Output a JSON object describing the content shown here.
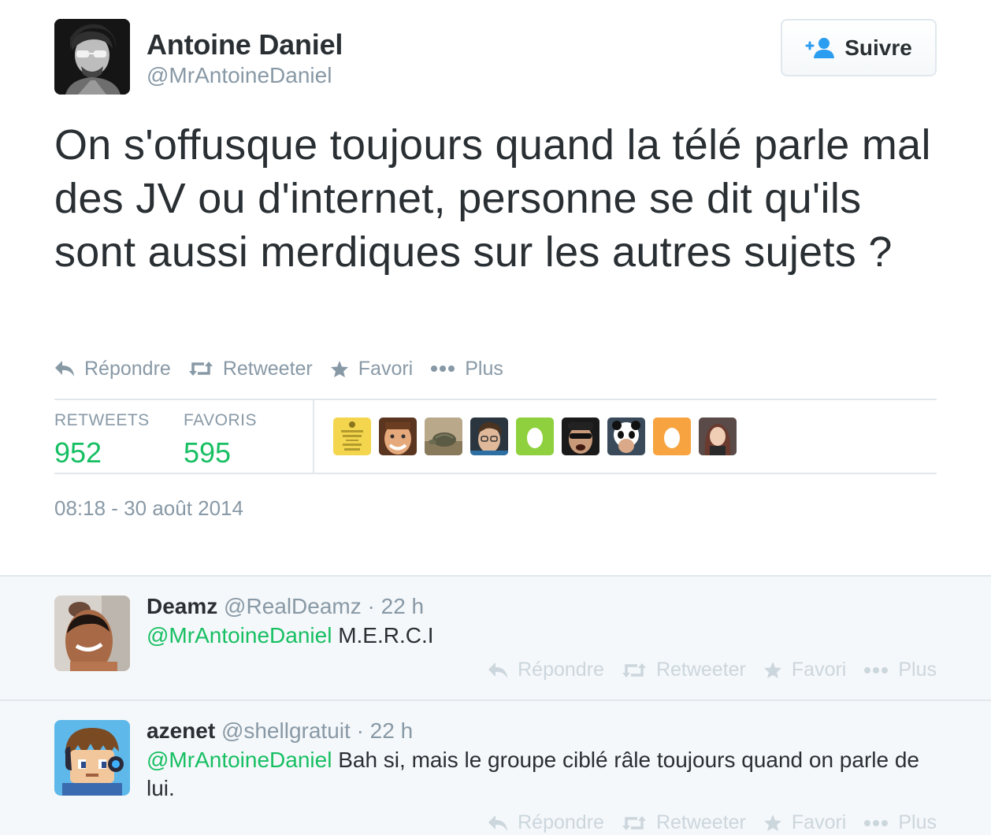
{
  "tweet": {
    "author_name": "Antoine Daniel",
    "author_handle": "@MrAntoineDaniel",
    "follow_label": "Suivre",
    "text": "On s'offusque toujours quand la télé parle mal des JV ou d'internet, personne se dit qu'ils sont aussi merdiques sur les autres sujets ?",
    "actions": {
      "reply": "Répondre",
      "retweet": "Retweeter",
      "favorite": "Favori",
      "more": "Plus"
    },
    "stats": {
      "retweets_label": "RETWEETS",
      "retweets_value": "952",
      "favorites_label": "FAVORIS",
      "favorites_value": "595"
    },
    "timestamp": "08:18 - 30 août 2014"
  },
  "replies": [
    {
      "name": "Deamz",
      "handle": "@RealDeamz",
      "time": "· 22 h",
      "mention": "@MrAntoineDaniel",
      "text": " M.E.R.C.I",
      "actions": {
        "reply": "Répondre",
        "retweet": "Retweeter",
        "favorite": "Favori",
        "more": "Plus"
      }
    },
    {
      "name": "azenet",
      "handle": "@shellgratuit",
      "time": "· 22 h",
      "mention": "@MrAntoineDaniel",
      "text": " Bah si, mais le groupe ciblé râle toujours quand on parle de lui.",
      "actions": {
        "reply": "Répondre",
        "retweet": "Retweeter",
        "favorite": "Favori",
        "more": "Plus"
      }
    }
  ],
  "colors": {
    "text": "#292f33",
    "muted": "#8899a6",
    "accent_green": "#17bf63",
    "follow_icon_blue": "#2b9df0",
    "border": "#e1e8ed",
    "reply_bg": "#f5f8fa"
  },
  "icons": [
    "reply-icon",
    "retweet-icon",
    "star-icon",
    "more-dots-icon",
    "follow-person-icon"
  ]
}
